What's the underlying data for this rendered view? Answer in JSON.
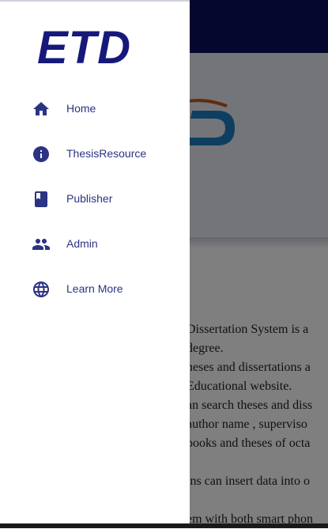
{
  "brand": {
    "title": "ETD"
  },
  "drawer": {
    "items": [
      {
        "label": "Home",
        "icon": "home-icon"
      },
      {
        "label": "ThesisResource",
        "icon": "info-icon"
      },
      {
        "label": "Publisher",
        "icon": "book-icon"
      },
      {
        "label": "Admin",
        "icon": "people-icon"
      },
      {
        "label": "Learn More",
        "icon": "globe-icon"
      }
    ]
  },
  "page": {
    "lines": [
      "Dissertation System is a",
      "degree.",
      "heses and dissertations a",
      " Educational website.",
      "an search theses and diss",
      "author name , superviso",
      "books and theses of octa",
      "",
      "ins can insert data into o",
      "",
      "em with both smart phon"
    ]
  },
  "colors": {
    "primary": "#2b3384",
    "topbar": "#0b0f5c",
    "brand": "#16197a"
  }
}
